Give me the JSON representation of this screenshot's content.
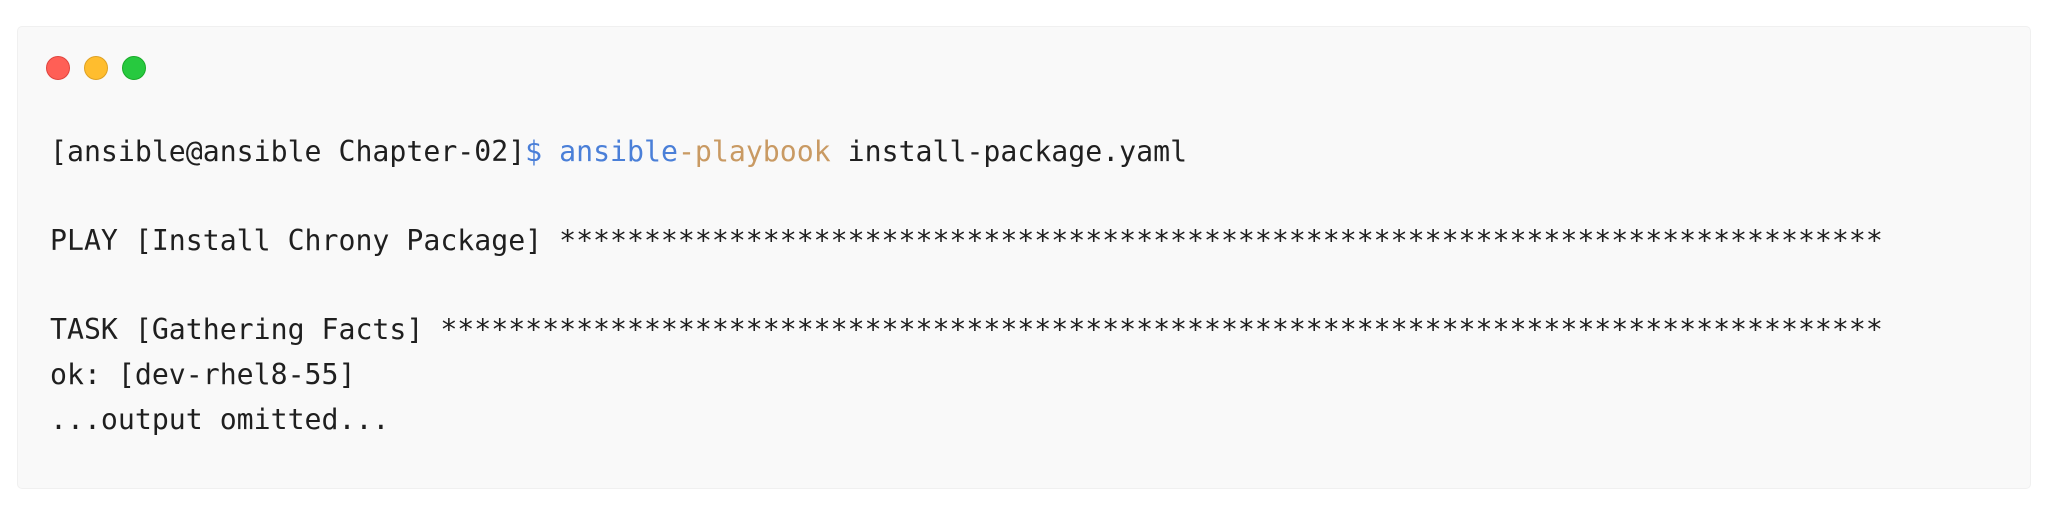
{
  "window": {
    "controls": {
      "close": "close",
      "minimize": "minimize",
      "zoom": "zoom"
    }
  },
  "terminal": {
    "prompt": "[ansible@ansible Chapter-02]",
    "prompt_symbol": "$",
    "command_part1": "ansible",
    "command_part2": "-playbook",
    "command_args": "install-package.yaml",
    "lines": [
      "",
      "PLAY [Install Chrony Package] ******************************************************************************",
      "",
      "TASK [Gathering Facts] *************************************************************************************",
      "ok: [dev-rhel8-55]",
      "...output omitted..."
    ]
  },
  "colors": {
    "prompt_symbol": "#4a7fd8",
    "command_part1": "#4a7fd8",
    "command_part2": "#c99a63",
    "text": "#1f1f1f",
    "background": "#f9f9f9"
  }
}
